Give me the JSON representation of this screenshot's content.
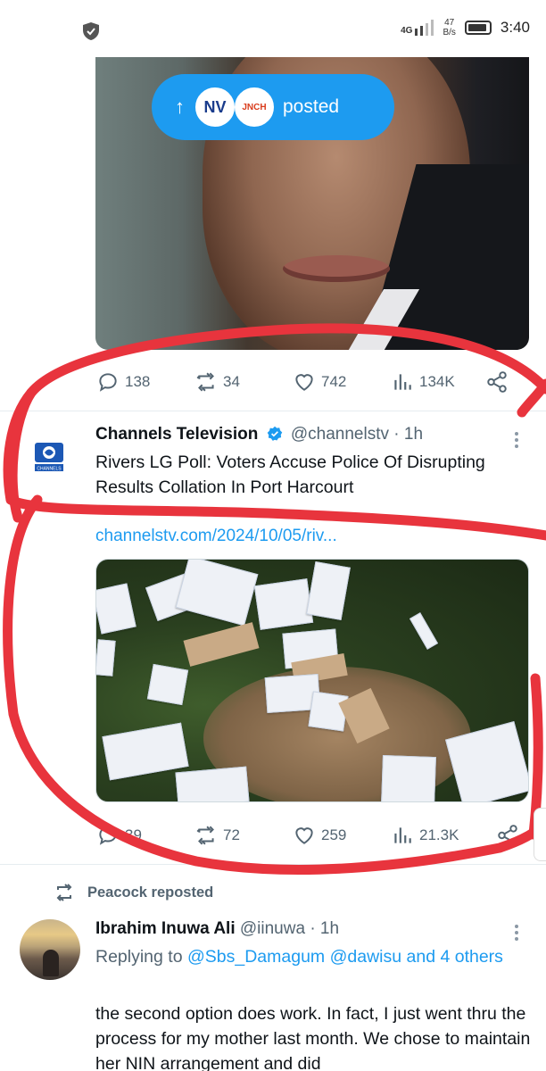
{
  "status_bar": {
    "network": "4G",
    "speed_value": "47",
    "speed_unit": "B/s",
    "time": "3:40"
  },
  "post1": {
    "posted_label": "posted",
    "avatar_nv": "NV",
    "avatar_jn": "JNCH",
    "stats": {
      "replies": "138",
      "reposts": "34",
      "likes": "742",
      "views": "134K"
    }
  },
  "post2": {
    "display_name": "Channels Television",
    "handle": "@channelstv",
    "time": "· 1h",
    "avatar_label": "CHANNELS",
    "text": "Rivers LG Poll: Voters Accuse Police Of Disrupting Results Collation In Port Harcourt",
    "link": "channelstv.com/2024/10/05/riv...",
    "stats": {
      "replies": "39",
      "reposts": "72",
      "likes": "259",
      "views": "21.3K"
    }
  },
  "post3": {
    "repost_label": "Peacock reposted",
    "display_name": "Ibrahim Inuwa Ali",
    "handle": "@iinuwa",
    "time": "· 1h",
    "replying_to_label": "Replying to",
    "mentions": "@Sbs_Damagum @dawisu and 4 others",
    "text": "the second option does work. In fact, I just went thru the process for my mother last month. We chose to maintain her NIN arrangement and did"
  },
  "colors": {
    "accent": "#1d9bf0",
    "muted": "#536471",
    "annotation": "#e8343d"
  }
}
